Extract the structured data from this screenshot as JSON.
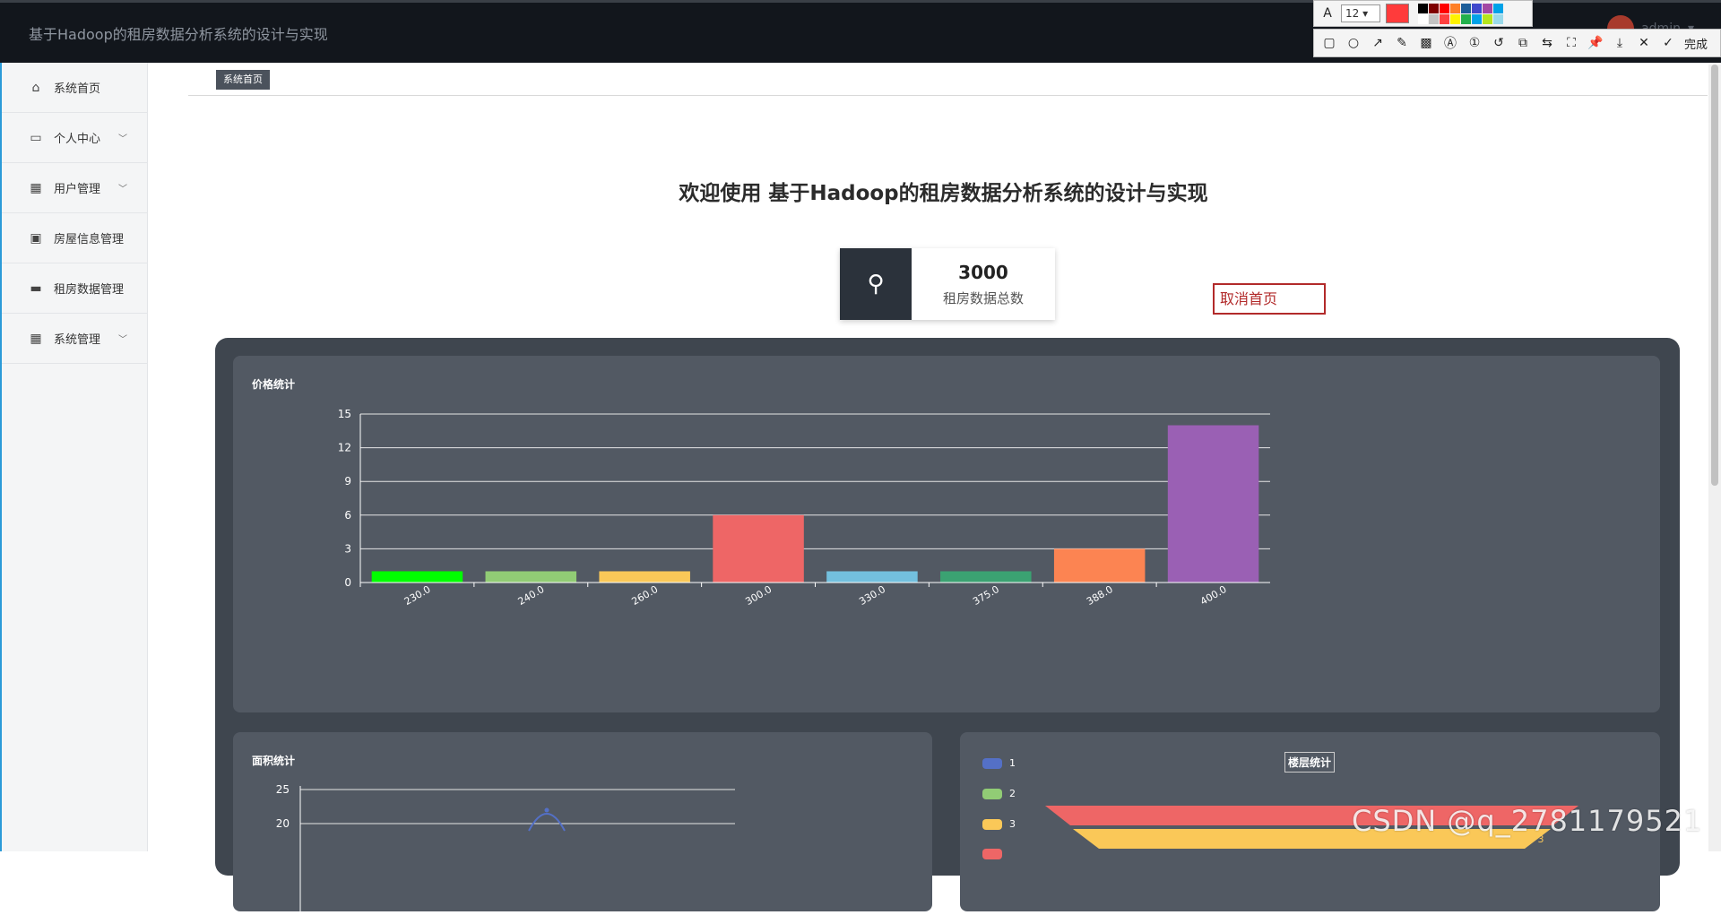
{
  "header": {
    "app_title": "基于Hadoop的租房数据分析系统的设计与实现",
    "user_name": "admin"
  },
  "snip_toolbar": {
    "font_size": "12",
    "done_label": "完成",
    "current_color": "#ff3b3b",
    "palette": [
      "#000000",
      "#7f0000",
      "#ff0000",
      "#ff7f27",
      "#1c5d99",
      "#3f48cc",
      "#a349a4",
      "#00a2e8",
      "#ffffff",
      "#c3c3c3",
      "#ff4040",
      "#fff200",
      "#22b14c",
      "#00a2e8",
      "#b5e61d",
      "#99d9ea"
    ]
  },
  "sidebar": {
    "items": [
      {
        "label": "系统首页",
        "icon": "home-icon"
      },
      {
        "label": "个人中心",
        "icon": "card-icon"
      },
      {
        "label": "用户管理",
        "icon": "grid-icon"
      },
      {
        "label": "房屋信息管理",
        "icon": "clipboard-icon"
      },
      {
        "label": "租房数据管理",
        "icon": "briefcase-icon"
      },
      {
        "label": "系统管理",
        "icon": "grid-icon"
      }
    ]
  },
  "main": {
    "breadcrumb": "系统首页",
    "welcome": "欢迎使用 基于Hadoop的租房数据分析系统的设计与实现",
    "stat": {
      "value": "3000",
      "label": "租房数据总数"
    },
    "cancel_home": "取消首页"
  },
  "price_chart": {
    "title": "价格统计"
  },
  "area_chart": {
    "title": "面积统计"
  },
  "floor_chart": {
    "title": "楼层统计"
  },
  "watermark": "CSDN @q_2781179521",
  "chart_data": [
    {
      "type": "bar",
      "title": "价格统计",
      "categories": [
        "230.0",
        "240.0",
        "260.0",
        "300.0",
        "330.0",
        "375.0",
        "388.0",
        "400.0"
      ],
      "values": [
        1,
        1,
        1,
        6,
        1,
        1,
        3,
        14
      ],
      "colors": [
        "#00ff00",
        "#91cc75",
        "#fac858",
        "#ee6666",
        "#73c0de",
        "#3ba272",
        "#fc8452",
        "#9a60b4"
      ],
      "ylim": [
        0,
        15
      ],
      "yticks": [
        0,
        3,
        6,
        9,
        12,
        15
      ]
    },
    {
      "type": "line",
      "title": "面积统计",
      "ylim": [
        0,
        25
      ],
      "yticks": [
        20,
        25
      ]
    },
    {
      "type": "funnel",
      "title": "楼层统计",
      "legend": [
        "1",
        "2",
        "3",
        ""
      ],
      "legend_colors": [
        "#5470c6",
        "#91cc75",
        "#fac858",
        "#ee6666"
      ],
      "visible_label": "3"
    }
  ]
}
